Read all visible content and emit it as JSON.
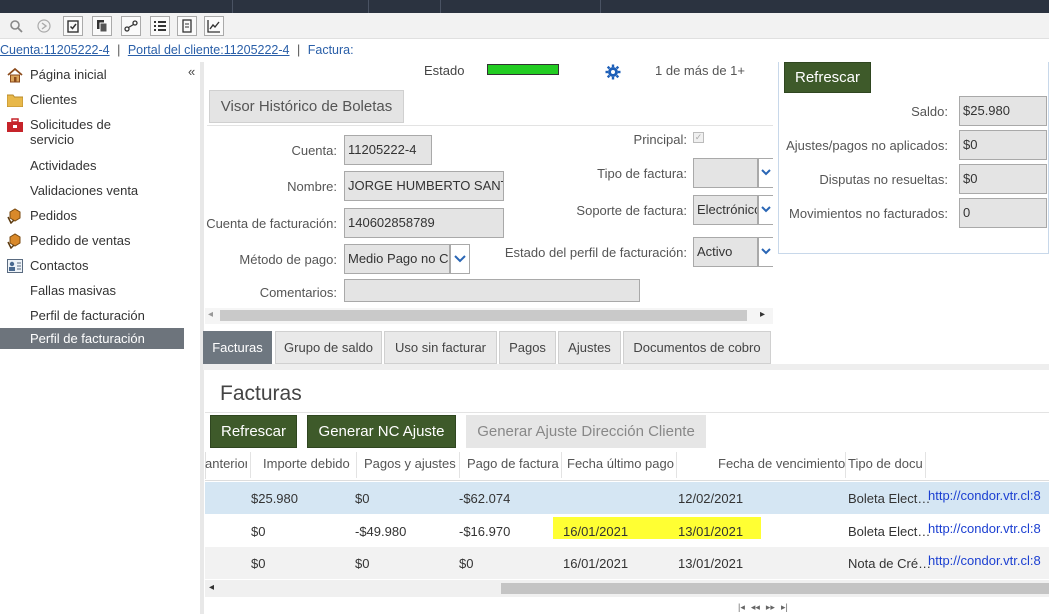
{
  "toolbar": {
    "icons": [
      "search-icon",
      "forward-icon",
      "clipboard-check-icon",
      "copy-icon",
      "link-icon",
      "list-icon",
      "document-icon",
      "chart-icon"
    ]
  },
  "breadcrumb": {
    "account": "Cuenta:11205222-4",
    "portal": "Portal del cliente:11205222-4",
    "current": "Factura:",
    "sep": "|"
  },
  "sidebar": {
    "collapse": "«",
    "items": [
      {
        "label": "Página inicial",
        "icon": "home-icon"
      },
      {
        "label": "Clientes",
        "icon": "folder-icon"
      },
      {
        "label": "Solicitudes de servicio",
        "icon": "toolbox-icon"
      },
      {
        "label": "Actividades",
        "icon": ""
      },
      {
        "label": "Validaciones venta",
        "icon": ""
      },
      {
        "label": "Pedidos",
        "icon": "orders-icon"
      },
      {
        "label": "Pedido de ventas",
        "icon": "orders-icon"
      },
      {
        "label": "Contactos",
        "icon": "contacts-icon"
      },
      {
        "label": "Fallas masivas",
        "icon": ""
      },
      {
        "label": "Perfil de facturación",
        "icon": ""
      },
      {
        "label": "Perfil de facturación",
        "icon": ""
      }
    ]
  },
  "header": {
    "estado_label": "Estado",
    "pager": "1 de más de 1+",
    "estado_color": "#22cc22"
  },
  "form": {
    "visor_button": "Visor Histórico de Boletas",
    "cuenta_label": "Cuenta:",
    "cuenta_value": "11205222-4",
    "nombre_label": "Nombre:",
    "nombre_value": "JORGE HUMBERTO SANTA",
    "cuenta_fact_label": "Cuenta de facturación:",
    "cuenta_fact_value": "140602858789",
    "metodo_label": "Método de pago:",
    "metodo_value": "Medio Pago no C",
    "comentarios_label": "Comentarios:",
    "principal_label": "Principal:",
    "tipo_factura_label": "Tipo de factura:",
    "tipo_factura_value": "",
    "soporte_label": "Soporte de factura:",
    "soporte_value": "Electrónico",
    "estado_perfil_label": "Estado del perfil de facturación:",
    "estado_perfil_value": "Activo"
  },
  "balance": {
    "refresh": "Refrescar",
    "saldo_label": "Saldo:",
    "saldo_value": "$25.980",
    "ajustes_label": "Ajustes/pagos no aplicados:",
    "ajustes_value": "$0",
    "disputas_label": "Disputas no resueltas:",
    "disputas_value": "$0",
    "movimientos_label": "Movimientos no facturados:",
    "movimientos_value": "0"
  },
  "tabs": [
    "Facturas",
    "Grupo de saldo",
    "Uso sin facturar",
    "Pagos",
    "Ajustes",
    "Documentos de cobro"
  ],
  "facturas": {
    "title": "Facturas",
    "btn_refresh": "Refrescar",
    "btn_nc": "Generar NC Ajuste",
    "btn_dir": "Generar Ajuste Dirección Cliente",
    "columns": [
      "anterior",
      "Importe debido",
      "Pagos y ajustes",
      "Pago de factura",
      "Fecha último pago",
      "Fecha de vencimiento",
      "Tipo de docu"
    ],
    "rows": [
      {
        "importe": "$25.980",
        "pagos": "$0",
        "pago_fact": "-$62.074",
        "fecha_pago": "",
        "vencimiento": "12/02/2021",
        "tipo": "Boleta Elect…",
        "link": "http://condor.vtr.cl:8"
      },
      {
        "importe": "$0",
        "pagos": "-$49.980",
        "pago_fact": "-$16.970",
        "fecha_pago": "16/01/2021",
        "vencimiento": "13/01/2021",
        "tipo": "Boleta Elect…",
        "link": "http://condor.vtr.cl:8"
      },
      {
        "importe": "$0",
        "pagos": "$0",
        "pago_fact": "$0",
        "fecha_pago": "16/01/2021",
        "vencimiento": "13/01/2021",
        "tipo": "Nota de Cré…",
        "link": "http://condor.vtr.cl:8"
      }
    ],
    "pager_icons": [
      "first-page-icon",
      "prev-page-icon",
      "next-page-icon",
      "last-page-icon"
    ]
  }
}
